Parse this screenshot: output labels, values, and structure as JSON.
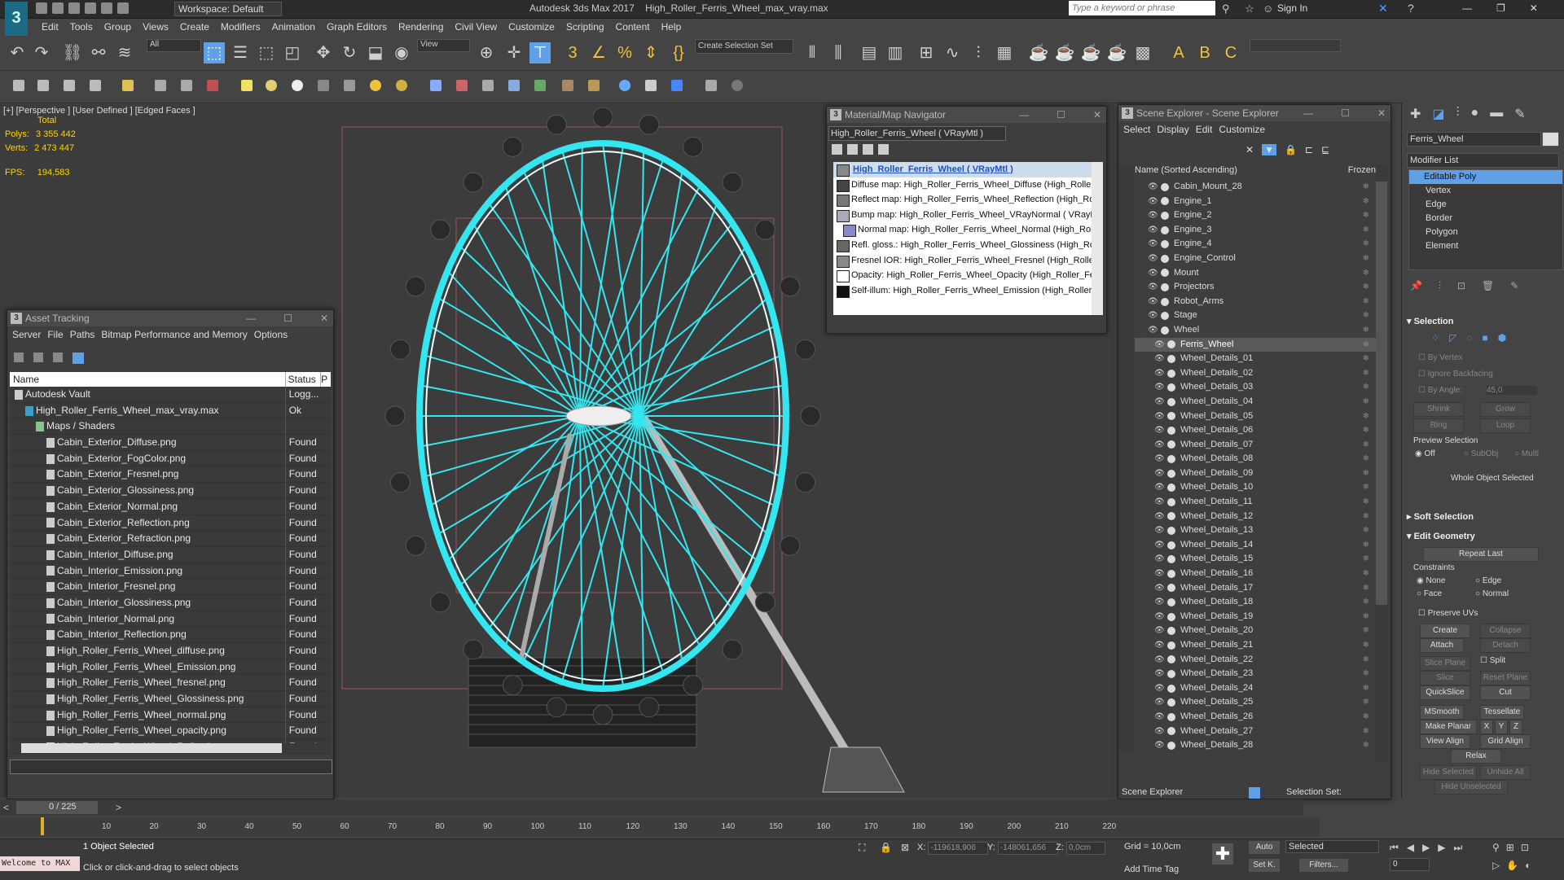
{
  "titlebar": {
    "logo": "3",
    "workspace": "Workspace: Default",
    "app_name": "Autodesk 3ds Max 2017",
    "file_name": "High_Roller_Ferris_Wheel_max_vray.max",
    "search_placeholder": "Type a keyword or phrase",
    "sign_in": "Sign In"
  },
  "menu": [
    "Edit",
    "Tools",
    "Group",
    "Views",
    "Create",
    "Modifiers",
    "Animation",
    "Graph Editors",
    "Rendering",
    "Civil View",
    "Customize",
    "Scripting",
    "Content",
    "Help"
  ],
  "toolbar": {
    "selection_filter": "All",
    "view": "View",
    "selection_set": "Create Selection Set"
  },
  "viewport": {
    "label": "[+] [Perspective ] [User Defined ] [Edged Faces ]",
    "stats_title": "Total",
    "polys_label": "Polys:",
    "polys_value": "3 355 442",
    "verts_label": "Verts:",
    "verts_value": "2 473 447",
    "fps_label": "FPS:",
    "fps_value": "194,583"
  },
  "asset_tracking": {
    "title": "Asset Tracking",
    "menu": [
      "Server",
      "File",
      "Paths",
      "Bitmap Performance and Memory",
      "Options"
    ],
    "col_name": "Name",
    "col_status": "Status",
    "col_extra": "P",
    "rows": [
      {
        "name": "Autodesk Vault",
        "status": "Logg...",
        "indent": 0
      },
      {
        "name": "High_Roller_Ferris_Wheel_max_vray.max",
        "status": "Ok",
        "indent": 1
      },
      {
        "name": "Maps / Shaders",
        "status": "",
        "indent": 2
      },
      {
        "name": "Cabin_Exterior_Diffuse.png",
        "status": "Found",
        "indent": 3
      },
      {
        "name": "Cabin_Exterior_FogColor.png",
        "status": "Found",
        "indent": 3
      },
      {
        "name": "Cabin_Exterior_Fresnel.png",
        "status": "Found",
        "indent": 3
      },
      {
        "name": "Cabin_Exterior_Glossiness.png",
        "status": "Found",
        "indent": 3
      },
      {
        "name": "Cabin_Exterior_Normal.png",
        "status": "Found",
        "indent": 3
      },
      {
        "name": "Cabin_Exterior_Reflection.png",
        "status": "Found",
        "indent": 3
      },
      {
        "name": "Cabin_Exterior_Refraction.png",
        "status": "Found",
        "indent": 3
      },
      {
        "name": "Cabin_Interior_Diffuse.png",
        "status": "Found",
        "indent": 3
      },
      {
        "name": "Cabin_Interior_Emission.png",
        "status": "Found",
        "indent": 3
      },
      {
        "name": "Cabin_Interior_Fresnel.png",
        "status": "Found",
        "indent": 3
      },
      {
        "name": "Cabin_Interior_Glossiness.png",
        "status": "Found",
        "indent": 3
      },
      {
        "name": "Cabin_Interior_Normal.png",
        "status": "Found",
        "indent": 3
      },
      {
        "name": "Cabin_Interior_Reflection.png",
        "status": "Found",
        "indent": 3
      },
      {
        "name": "High_Roller_Ferris_Wheel_diffuse.png",
        "status": "Found",
        "indent": 3
      },
      {
        "name": "High_Roller_Ferris_Wheel_Emission.png",
        "status": "Found",
        "indent": 3
      },
      {
        "name": "High_Roller_Ferris_Wheel_fresnel.png",
        "status": "Found",
        "indent": 3
      },
      {
        "name": "High_Roller_Ferris_Wheel_Glossiness.png",
        "status": "Found",
        "indent": 3
      },
      {
        "name": "High_Roller_Ferris_Wheel_normal.png",
        "status": "Found",
        "indent": 3
      },
      {
        "name": "High_Roller_Ferris_Wheel_opacity.png",
        "status": "Found",
        "indent": 3
      },
      {
        "name": "High_Roller_Ferris_Wheel_Reflection.png",
        "status": "Found",
        "indent": 3
      }
    ]
  },
  "material_navigator": {
    "title": "Material/Map Navigator",
    "current": "High_Roller_Ferris_Wheel  ( VRayMtl )",
    "root": "High_Roller_Ferris_Wheel  ( VRayMtl )",
    "maps": [
      "Diffuse map: High_Roller_Ferris_Wheel_Diffuse (High_Roller",
      "Reflect map: High_Roller_Ferris_Wheel_Reflection (High_Ro",
      "Bump map: High_Roller_Ferris_Wheel_VRayNormal  ( VRayN",
      "Normal map: High_Roller_Ferris_Wheel_Normal (High_Roll",
      "Refl. gloss.: High_Roller_Ferris_Wheel_Glossiness (High_Roll",
      "Fresnel IOR: High_Roller_Ferris_Wheel_Fresnel (High_Roller",
      "Opacity: High_Roller_Ferris_Wheel_Opacity (High_Roller_Fe",
      "Self-illum: High_Roller_Ferris_Wheel_Emission (High_Roller_"
    ]
  },
  "scene_explorer": {
    "title": "Scene Explorer - Scene Explorer",
    "menu": [
      "Select",
      "Display",
      "Edit",
      "Customize"
    ],
    "col_name": "Name (Sorted Ascending)",
    "col_frozen": "Frozen",
    "items": [
      {
        "name": "Cabin_Mount_28",
        "level": 0
      },
      {
        "name": "Engine_1",
        "level": 0
      },
      {
        "name": "Engine_2",
        "level": 0
      },
      {
        "name": "Engine_3",
        "level": 0
      },
      {
        "name": "Engine_4",
        "level": 0
      },
      {
        "name": "Engine_Control",
        "level": 0
      },
      {
        "name": "Mount",
        "level": 0
      },
      {
        "name": "Projectors",
        "level": 0
      },
      {
        "name": "Robot_Arms",
        "level": 0
      },
      {
        "name": "Stage",
        "level": 0
      },
      {
        "name": "Wheel",
        "level": 0
      },
      {
        "name": "Ferris_Wheel",
        "level": 1
      },
      {
        "name": "Wheel_Details_01",
        "level": 1
      },
      {
        "name": "Wheel_Details_02",
        "level": 1
      },
      {
        "name": "Wheel_Details_03",
        "level": 1
      },
      {
        "name": "Wheel_Details_04",
        "level": 1
      },
      {
        "name": "Wheel_Details_05",
        "level": 1
      },
      {
        "name": "Wheel_Details_06",
        "level": 1
      },
      {
        "name": "Wheel_Details_07",
        "level": 1
      },
      {
        "name": "Wheel_Details_08",
        "level": 1
      },
      {
        "name": "Wheel_Details_09",
        "level": 1
      },
      {
        "name": "Wheel_Details_10",
        "level": 1
      },
      {
        "name": "Wheel_Details_11",
        "level": 1
      },
      {
        "name": "Wheel_Details_12",
        "level": 1
      },
      {
        "name": "Wheel_Details_13",
        "level": 1
      },
      {
        "name": "Wheel_Details_14",
        "level": 1
      },
      {
        "name": "Wheel_Details_15",
        "level": 1
      },
      {
        "name": "Wheel_Details_16",
        "level": 1
      },
      {
        "name": "Wheel_Details_17",
        "level": 1
      },
      {
        "name": "Wheel_Details_18",
        "level": 1
      },
      {
        "name": "Wheel_Details_19",
        "level": 1
      },
      {
        "name": "Wheel_Details_20",
        "level": 1
      },
      {
        "name": "Wheel_Details_21",
        "level": 1
      },
      {
        "name": "Wheel_Details_22",
        "level": 1
      },
      {
        "name": "Wheel_Details_23",
        "level": 1
      },
      {
        "name": "Wheel_Details_24",
        "level": 1
      },
      {
        "name": "Wheel_Details_25",
        "level": 1
      },
      {
        "name": "Wheel_Details_26",
        "level": 1
      },
      {
        "name": "Wheel_Details_27",
        "level": 1
      },
      {
        "name": "Wheel_Details_28",
        "level": 1
      }
    ],
    "selected": "Ferris_Wheel",
    "footer_name": "Scene Explorer",
    "footer_selset": "Selection Set:"
  },
  "command_panel": {
    "object_name": "Ferris_Wheel",
    "modifier_list": "Modifier List",
    "stack": [
      "Editable Poly",
      "Vertex",
      "Edge",
      "Border",
      "Polygon",
      "Element"
    ],
    "selection": {
      "title": "Selection",
      "by_vertex": "By Vertex",
      "ignore_backfacing": "Ignore Backfacing",
      "by_angle": "By Angle:",
      "angle_value": "45,0",
      "shrink": "Shrink",
      "grow": "Grow",
      "ring": "Ring",
      "loop": "Loop",
      "preview": "Preview Selection",
      "off": "Off",
      "subobj": "SubObj",
      "multi": "Multi",
      "status": "Whole Object Selected"
    },
    "soft_selection": "Soft Selection",
    "edit_geometry": {
      "title": "Edit Geometry",
      "repeat_last": "Repeat Last",
      "constraints": "Constraints",
      "none": "None",
      "edge": "Edge",
      "face": "Face",
      "normal": "Normal",
      "preserve_uvs": "Preserve UVs",
      "create": "Create",
      "collapse": "Collapse",
      "attach": "Attach",
      "detach": "Detach",
      "slice_plane": "Slice Plane",
      "split": "Split",
      "slice": "Slice",
      "reset_plane": "Reset Plane",
      "quickslice": "QuickSlice",
      "cut": "Cut",
      "msmooth": "MSmooth",
      "tessellate": "Tessellate",
      "make_planar": "Make Planar",
      "x": "X",
      "y": "Y",
      "z": "Z",
      "view_align": "View Align",
      "grid_align": "Grid Align",
      "relax": "Relax",
      "hide_selected": "Hide Selected",
      "unhide_all": "Unhide All",
      "hide_unselected": "Hide Unselected"
    }
  },
  "timeline": {
    "frame": "0 / 225",
    "ticks": [
      "10",
      "20",
      "30",
      "40",
      "50",
      "60",
      "70",
      "80",
      "90",
      "100",
      "110",
      "120",
      "130",
      "140",
      "150",
      "160",
      "170",
      "180",
      "190",
      "200",
      "210",
      "220"
    ]
  },
  "status": {
    "listener": "Welcome to MAX",
    "selected": "1 Object Selected",
    "prompt": "Click or click-and-drag to select objects",
    "x_label": "X:",
    "x_value": "-119618,906",
    "y_label": "Y:",
    "y_value": "-148061,656",
    "z_label": "Z:",
    "z_value": "0,0cm",
    "grid": "Grid = 10,0cm",
    "add_time_tag": "Add Time Tag",
    "auto": "Auto",
    "selected_mode": "Selected",
    "set_k": "Set K.",
    "filters": "Filters...",
    "frame_field": "0"
  },
  "colors": {
    "wheel_highlight": "#33e6f0",
    "bg_viewport": "#3c3c3c",
    "stats_yellow": "#ffd400",
    "selection_blue": "#5fa0e6"
  }
}
